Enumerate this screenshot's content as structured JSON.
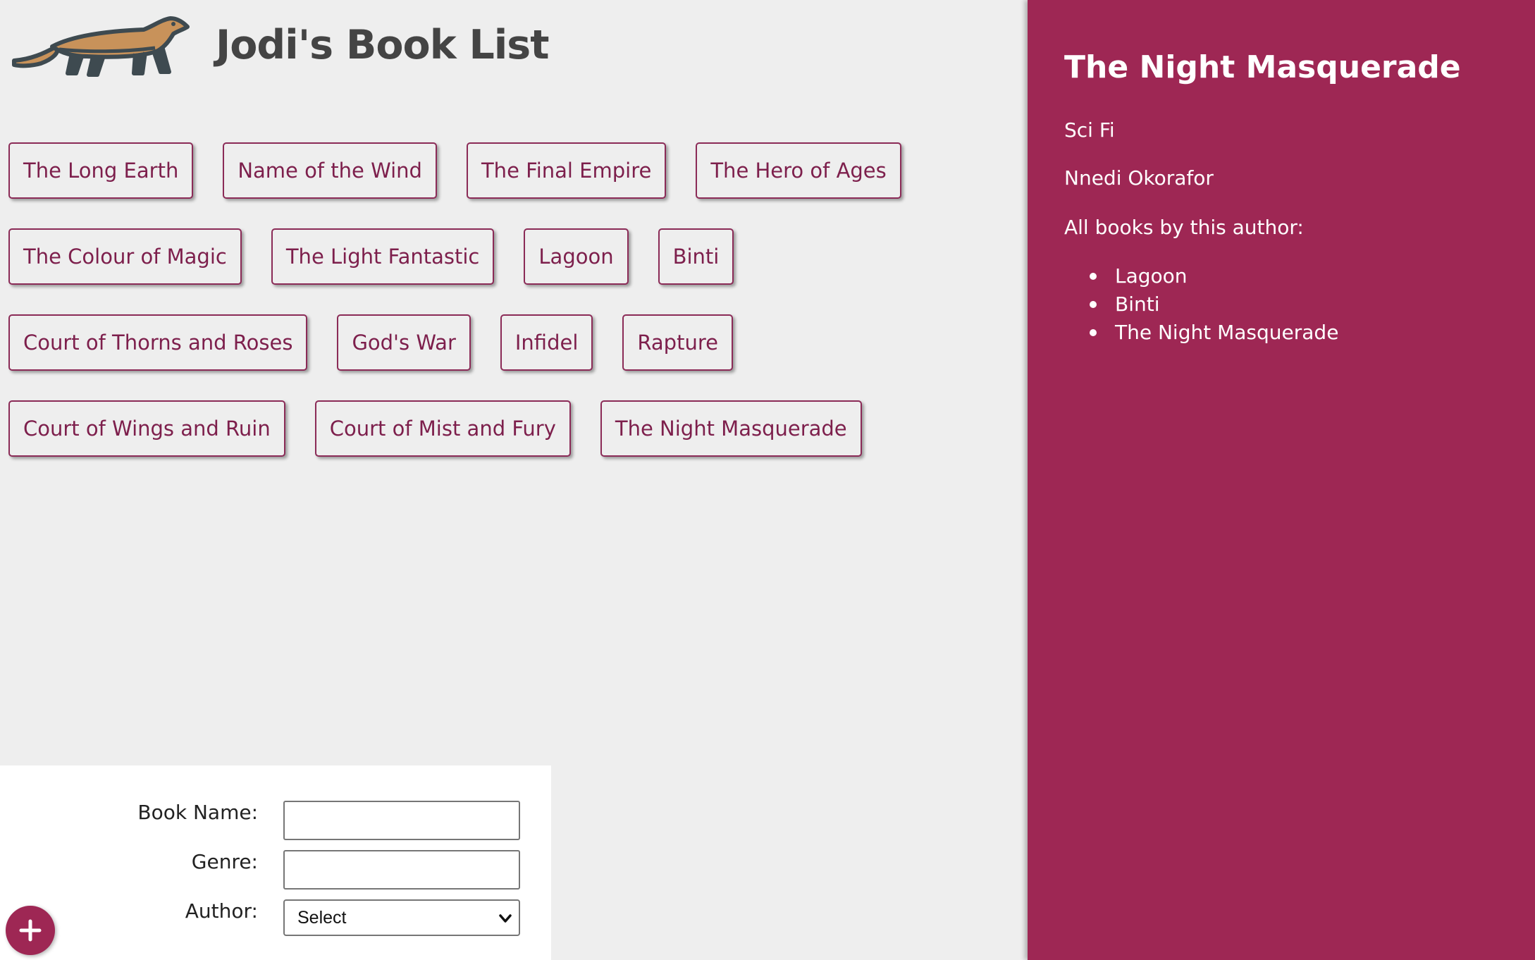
{
  "app": {
    "title": "Jodi's Book List",
    "logo_icon": "weasel-icon"
  },
  "colors": {
    "accent": "#9e2754",
    "button_text": "#7d1f4c",
    "background": "#eeeeee"
  },
  "books": {
    "rows": [
      [
        "The Long Earth",
        "Name of the Wind",
        "The Final Empire",
        "The Hero of Ages"
      ],
      [
        "The Colour of Magic",
        "The Light Fantastic",
        "Lagoon",
        "Binti"
      ],
      [
        "Court of Thorns and Roses",
        "God's War",
        "Infidel",
        "Rapture"
      ],
      [
        "Court of Wings and Ruin",
        "Court of Mist and Fury",
        "The Night Masquerade"
      ]
    ]
  },
  "form": {
    "book_name_label": "Book Name:",
    "book_name_value": "",
    "genre_label": "Genre:",
    "genre_value": "",
    "author_label": "Author:",
    "author_selected": "Select",
    "add_icon": "plus-icon"
  },
  "details": {
    "title": "The Night Masquerade",
    "genre": "Sci Fi",
    "author": "Nnedi Okorafor",
    "all_books_label": "All books by this author:",
    "author_books": [
      "Lagoon",
      "Binti",
      "The Night Masquerade"
    ]
  }
}
